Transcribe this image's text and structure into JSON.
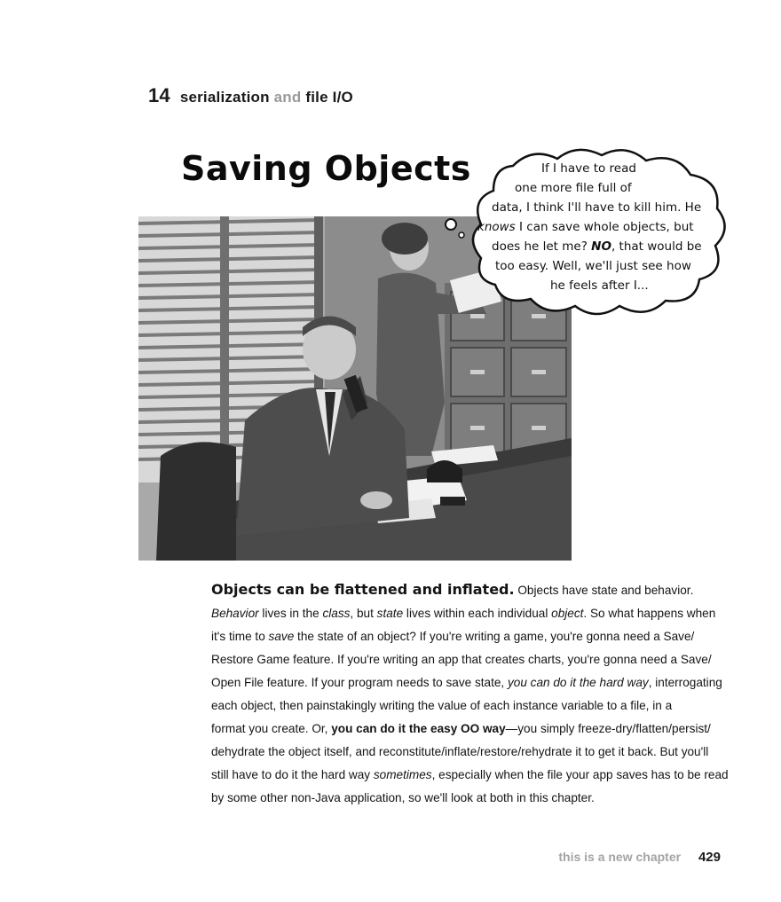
{
  "header": {
    "chapter_number": "14",
    "part1": "serialization",
    "part2": "and",
    "part3": "file I/O"
  },
  "title": "Saving Objects",
  "thought_bubble": {
    "l1": "If I have to read",
    "l2": "one more file full of",
    "l3": "data, I think I'll have to kill him. He",
    "l4a": "knows",
    "l4b": " I can save whole objects, but",
    "l5a": "does he let me? ",
    "l5b": "NO",
    "l5c": ", that would be",
    "l6": "too easy. Well, we'll just see how",
    "l7": "he feels after I..."
  },
  "body": {
    "lead": "Objects can be flattened and inflated.",
    "l1": " Objects have state and behavior.",
    "l2a": "Behavior",
    "l2b": " lives in the ",
    "l2c": "class",
    "l2d": ", but ",
    "l2e": "state",
    "l2f": " lives within each individual ",
    "l2g": "object",
    "l2h": ". So what happens when",
    "l3a": "it's time to ",
    "l3b": "save",
    "l3c": " the state of an object? If you're writing a game, you're gonna need a Save/",
    "l4": "Restore Game feature. If you're writing an app that creates charts, you're gonna need a Save/",
    "l5a": "Open File feature.  If your program needs to save state, ",
    "l5b": "you can do it the hard way",
    "l5c": ", interrogating",
    "l6": "each object, then painstakingly writing the value of each instance variable to a file, in a",
    "l7a": "format you create. Or, ",
    "l7b": "you can do it the easy OO way",
    "l7c": "—you simply freeze-dry/flatten/persist/",
    "l8": "dehydrate the object itself, and reconstitute/inflate/restore/rehydrate it to get it back. But you'll",
    "l9a": "still have to do it the hard way ",
    "l9b": "sometimes",
    "l9c": ", especially when the file your app saves has to be read",
    "l10": "by some other non-Java application, so we'll look at both in this chapter."
  },
  "footer": {
    "note": "this is a new chapter",
    "page": "429"
  }
}
